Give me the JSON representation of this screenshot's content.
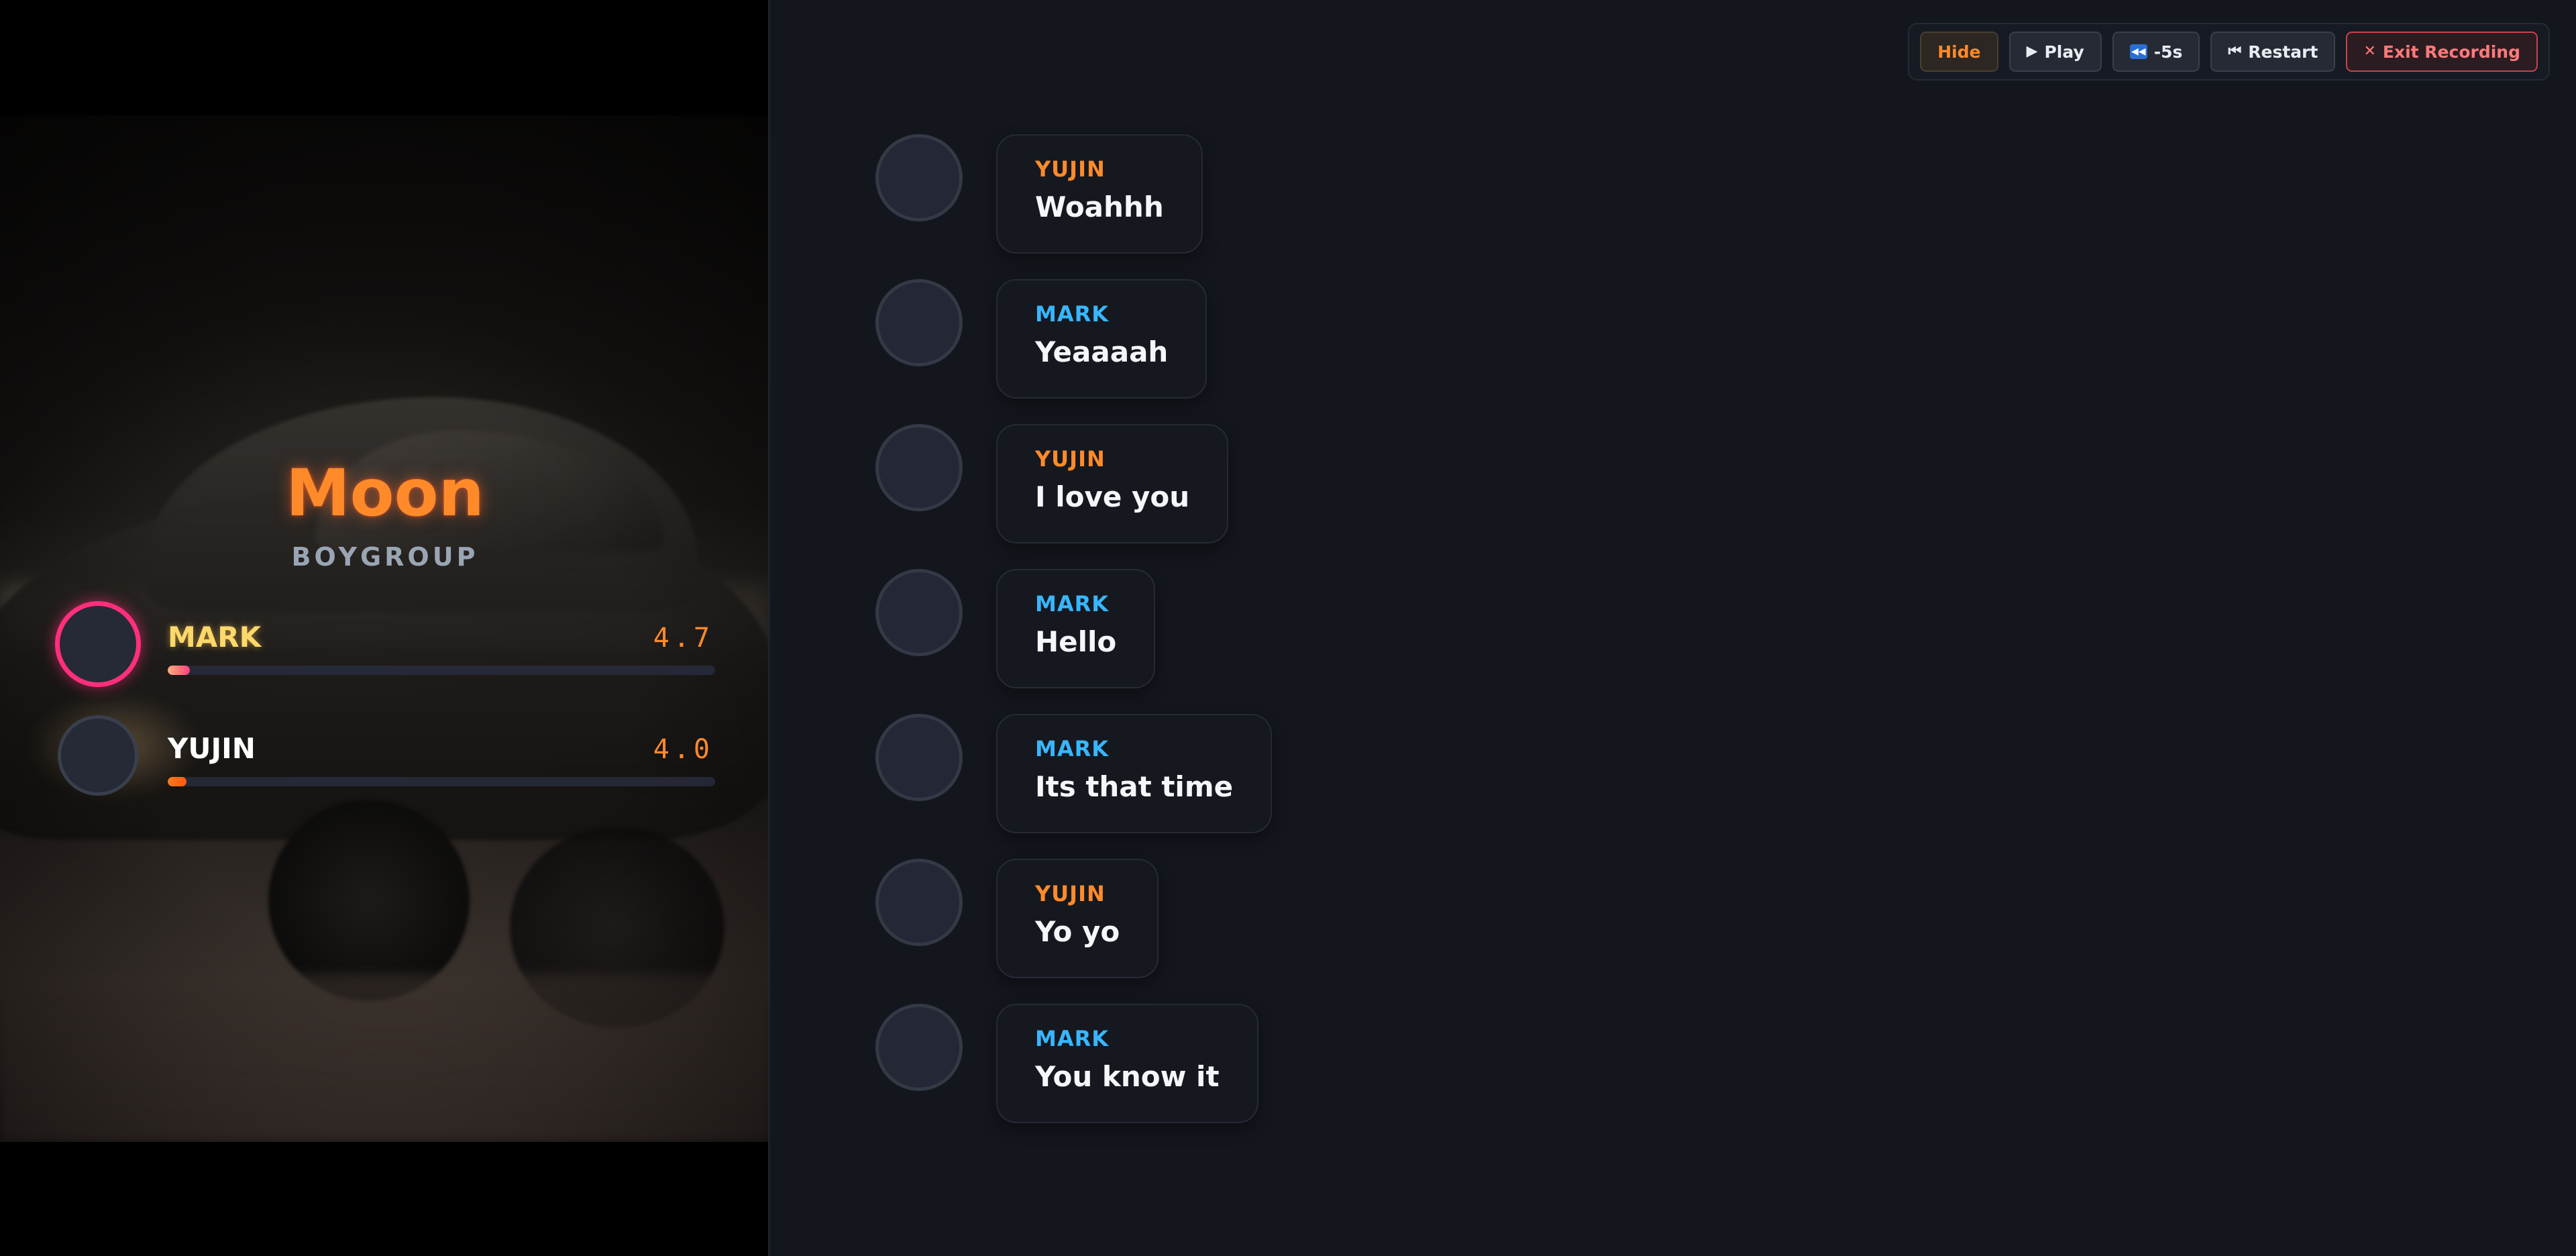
{
  "toolbar": {
    "hide_label": "Hide",
    "play_label": "Play",
    "rewind_label": "-5s",
    "restart_label": "Restart",
    "exit_label": "Exit Recording"
  },
  "video": {
    "song_title": "Moon",
    "artist": "BOYGROUP"
  },
  "scoreboard": {
    "players": [
      {
        "name": "MARK",
        "score": "4.7",
        "progress": 0.04,
        "highlighted": true
      },
      {
        "name": "YUJIN",
        "score": "4.0",
        "progress": 0.034,
        "highlighted": false
      }
    ]
  },
  "chat": {
    "messages": [
      {
        "sender": "YUJIN",
        "text": "Woahhh"
      },
      {
        "sender": "MARK",
        "text": "Yeaaaah"
      },
      {
        "sender": "YUJIN",
        "text": "I love you"
      },
      {
        "sender": "MARK",
        "text": "Hello"
      },
      {
        "sender": "MARK",
        "text": "Its that time"
      },
      {
        "sender": "YUJIN",
        "text": "Yo yo"
      },
      {
        "sender": "MARK",
        "text": "You know it"
      }
    ]
  },
  "colors": {
    "yujin": "#ff8a2a",
    "mark": "#38b6ff",
    "highlight_ring": "#ff2f7a",
    "exit_border": "#c8434a"
  },
  "icons": {
    "play": "play-icon",
    "rewind": "rewind-icon",
    "restart": "skip-back-icon",
    "exit": "close-icon"
  }
}
